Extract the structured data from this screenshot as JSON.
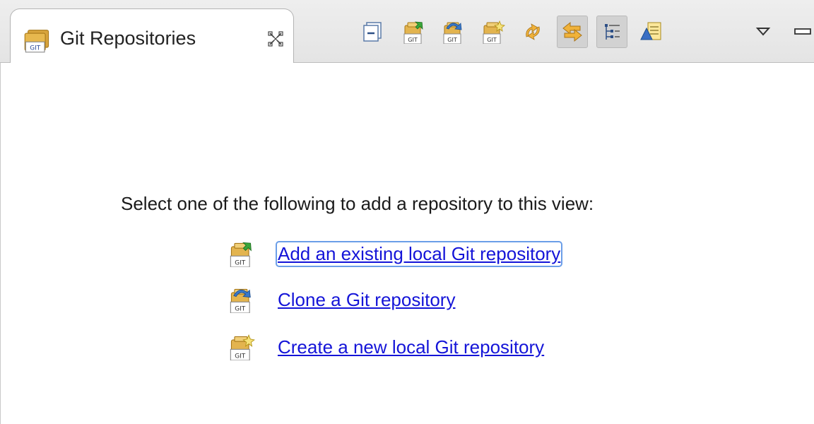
{
  "tab": {
    "title": "Git Repositories",
    "icon": "git-repositories-icon",
    "close_icon": "close-icon"
  },
  "toolbar": {
    "buttons": [
      {
        "icon": "collapse-all-icon"
      },
      {
        "icon": "add-repository-icon"
      },
      {
        "icon": "clone-repository-icon"
      },
      {
        "icon": "create-repository-icon"
      },
      {
        "icon": "refresh-icon"
      },
      {
        "icon": "link-with-selection-icon",
        "pressed": true
      },
      {
        "icon": "hierarchical-layout-icon",
        "pressed": true
      },
      {
        "icon": "outline-icon"
      },
      {
        "icon": "view-menu-icon"
      },
      {
        "icon": "minimize-icon"
      }
    ]
  },
  "main": {
    "prompt": "Select one of the following to add a repository to this view:",
    "links": [
      {
        "label": "Add an existing local Git repository",
        "icon": "add-repository-icon"
      },
      {
        "label": "Clone a Git repository",
        "icon": "clone-repository-icon"
      },
      {
        "label": "Create a new local Git repository",
        "icon": "create-repository-icon"
      }
    ]
  },
  "colors": {
    "link": "#1414d8",
    "focus_outline": "#6b9ee8",
    "git_badge": "#e7a630"
  }
}
